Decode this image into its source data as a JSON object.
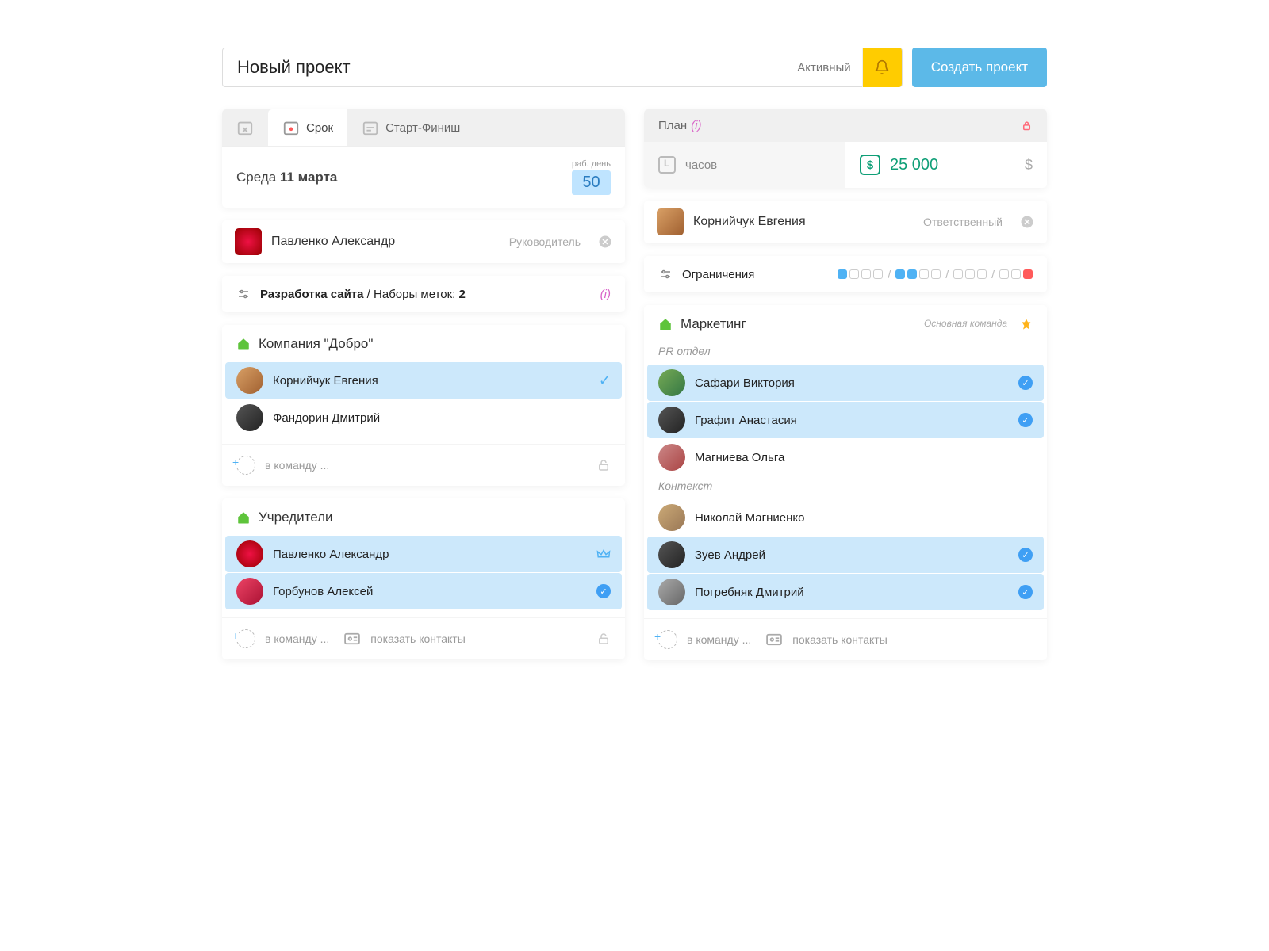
{
  "header": {
    "title": "Новый проект",
    "status": "Активный",
    "create_btn": "Создать проект"
  },
  "date_card": {
    "tab_deadline": "Срок",
    "tab_startfinish": "Старт-Финиш",
    "day_name": "Среда",
    "date": "11 марта",
    "days_label": "раб. день",
    "days_value": "50"
  },
  "plan_card": {
    "title": "План",
    "hours_label": "часов",
    "amount": "25 000",
    "currency": "$"
  },
  "left_person": {
    "name": "Павленко Александр",
    "role": "Руководитель"
  },
  "right_person": {
    "name": "Корнийчук Евгения",
    "role": "Ответственный"
  },
  "tags_row": {
    "text1": "Разработка сайта",
    "text2": "Наборы меток:",
    "count": "2"
  },
  "restrictions": {
    "label": "Ограничения"
  },
  "teams": {
    "dobro": {
      "title": "Компания \"Добро\"",
      "members": [
        {
          "name": "Корнийчук Евгения",
          "sel": true,
          "mark": "check"
        },
        {
          "name": "Фандорин Дмитрий",
          "sel": false
        }
      ],
      "add": "в команду ..."
    },
    "founders": {
      "title": "Учредители",
      "members": [
        {
          "name": "Павленко Александр",
          "sel": true,
          "mark": "crown"
        },
        {
          "name": "Горбунов Алексей",
          "sel": true,
          "mark": "badge"
        }
      ],
      "add": "в команду ...",
      "contacts": "показать контакты"
    },
    "marketing": {
      "title": "Маркетинг",
      "main_label": "Основная команда",
      "group1": "PR отдел",
      "group1_members": [
        {
          "name": "Сафари Виктория",
          "sel": true,
          "mark": "badge"
        },
        {
          "name": "Графит Анастасия",
          "sel": true,
          "mark": "badge"
        },
        {
          "name": "Магниева Ольга",
          "sel": false
        }
      ],
      "group2": "Контекст",
      "group2_members": [
        {
          "name": "Николай Магниенко",
          "sel": false
        },
        {
          "name": "Зуев Андрей",
          "sel": true,
          "mark": "badge"
        },
        {
          "name": "Погребняк Дмитрий",
          "sel": true,
          "mark": "badge"
        }
      ],
      "add": "в команду ...",
      "contacts": "показать контакты"
    }
  }
}
